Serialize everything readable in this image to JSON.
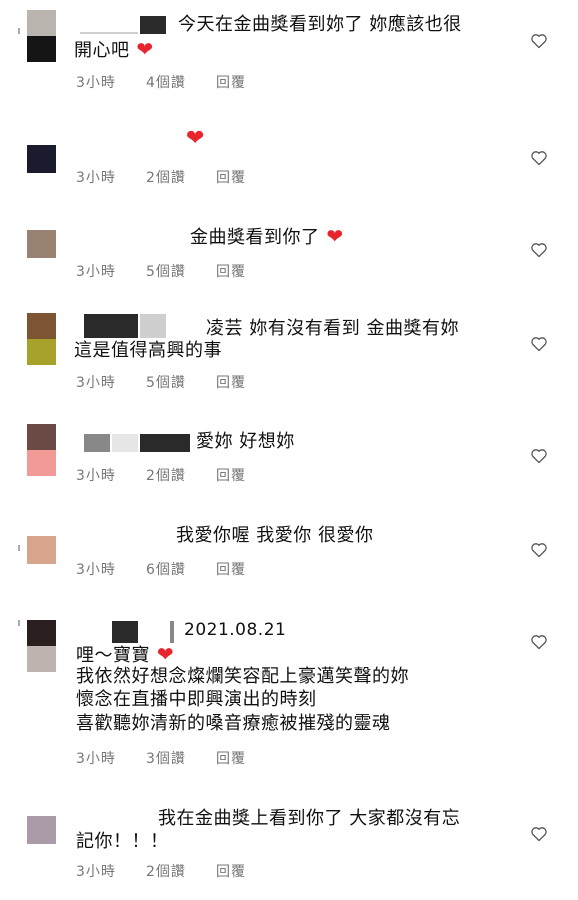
{
  "comments": [
    {
      "text_line1": "今天在金曲獎看到妳了 妳應該也很",
      "text_line2": "開心吧",
      "time": "3小時",
      "likes": "4個讚",
      "reply": "回覆",
      "avatar_colors": [
        "#b9b4ae",
        "#151515"
      ]
    },
    {
      "text_line1": "",
      "time": "3小時",
      "likes": "2個讚",
      "reply": "回覆",
      "avatar_colors": [
        "#1a1c2e"
      ]
    },
    {
      "text_line1": "金曲獎看到你了",
      "time": "3小時",
      "likes": "5個讚",
      "reply": "回覆",
      "avatar_colors": [
        "#9a8273"
      ]
    },
    {
      "text_line1": "凌芸 妳有沒有看到 金曲獎有妳",
      "text_line2": "這是值得高興的事",
      "time": "3小時",
      "likes": "5個讚",
      "reply": "回覆",
      "avatar_colors": [
        "#7d5532",
        "#a6a22a"
      ]
    },
    {
      "text_line1": "愛妳 好想妳",
      "time": "3小時",
      "likes": "2個讚",
      "reply": "回覆",
      "avatar_colors": [
        "#6a4a44",
        "#f29a96"
      ]
    },
    {
      "text_line1": "我愛你喔 我愛你 很愛你",
      "time": "3小時",
      "likes": "6個讚",
      "reply": "回覆",
      "avatar_colors": [
        "#d7a48c"
      ]
    },
    {
      "date": "2021.08.21",
      "text_line1": "哩～寶寶",
      "text_line2": "我依然好想念燦爛笑容配上豪邁笑聲的妳",
      "text_line3": "懷念在直播中即興演出的時刻",
      "text_line4": "喜歡聽妳清新的嗓音療癒被摧殘的靈魂",
      "time": "3小時",
      "likes": "3個讚",
      "reply": "回覆",
      "avatar_colors": [
        "#2a1f1e",
        "#bdb3af"
      ]
    },
    {
      "text_line1": "我在金曲獎上看到你了 大家都沒有忘",
      "text_line2": "記你！！！",
      "time": "3小時",
      "likes": "2個讚",
      "reply": "回覆",
      "avatar_colors": [
        "#ab9ba8"
      ]
    }
  ],
  "icons": {
    "like": "heart-outline-icon",
    "emoji": "red-heart-icon"
  },
  "colors": {
    "heart": "#e8242c",
    "meta": "#777777"
  }
}
